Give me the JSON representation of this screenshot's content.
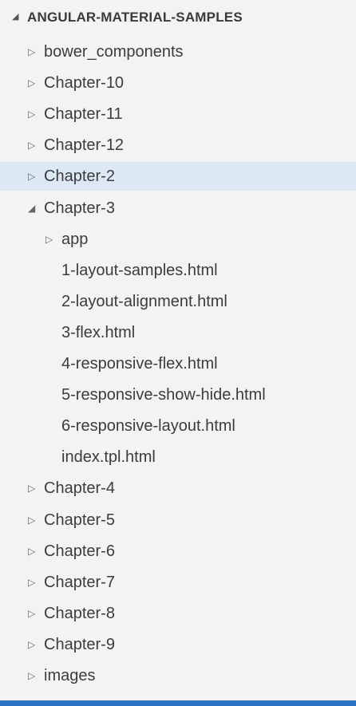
{
  "explorer": {
    "title": "ANGULAR-MATERIAL-SAMPLES",
    "items": [
      {
        "label": "bower_components",
        "depth": 1,
        "type": "folder",
        "expanded": false
      },
      {
        "label": "Chapter-10",
        "depth": 1,
        "type": "folder",
        "expanded": false
      },
      {
        "label": "Chapter-11",
        "depth": 1,
        "type": "folder",
        "expanded": false
      },
      {
        "label": "Chapter-12",
        "depth": 1,
        "type": "folder",
        "expanded": false
      },
      {
        "label": "Chapter-2",
        "depth": 1,
        "type": "folder",
        "expanded": false,
        "selected": true
      },
      {
        "label": "Chapter-3",
        "depth": 1,
        "type": "folder",
        "expanded": true
      },
      {
        "label": "app",
        "depth": 2,
        "type": "folder",
        "expanded": false
      },
      {
        "label": "1-layout-samples.html",
        "depth": 2,
        "type": "file"
      },
      {
        "label": "2-layout-alignment.html",
        "depth": 2,
        "type": "file"
      },
      {
        "label": "3-flex.html",
        "depth": 2,
        "type": "file"
      },
      {
        "label": "4-responsive-flex.html",
        "depth": 2,
        "type": "file"
      },
      {
        "label": "5-responsive-show-hide.html",
        "depth": 2,
        "type": "file"
      },
      {
        "label": "6-responsive-layout.html",
        "depth": 2,
        "type": "file"
      },
      {
        "label": "index.tpl.html",
        "depth": 2,
        "type": "file"
      },
      {
        "label": "Chapter-4",
        "depth": 1,
        "type": "folder",
        "expanded": false
      },
      {
        "label": "Chapter-5",
        "depth": 1,
        "type": "folder",
        "expanded": false
      },
      {
        "label": "Chapter-6",
        "depth": 1,
        "type": "folder",
        "expanded": false
      },
      {
        "label": "Chapter-7",
        "depth": 1,
        "type": "folder",
        "expanded": false
      },
      {
        "label": "Chapter-8",
        "depth": 1,
        "type": "folder",
        "expanded": false
      },
      {
        "label": "Chapter-9",
        "depth": 1,
        "type": "folder",
        "expanded": false
      },
      {
        "label": "images",
        "depth": 1,
        "type": "folder",
        "expanded": false
      }
    ]
  },
  "colors": {
    "selection": "#dde8f5",
    "background": "#f3f3f3",
    "status_bar": "#2b74c4"
  }
}
